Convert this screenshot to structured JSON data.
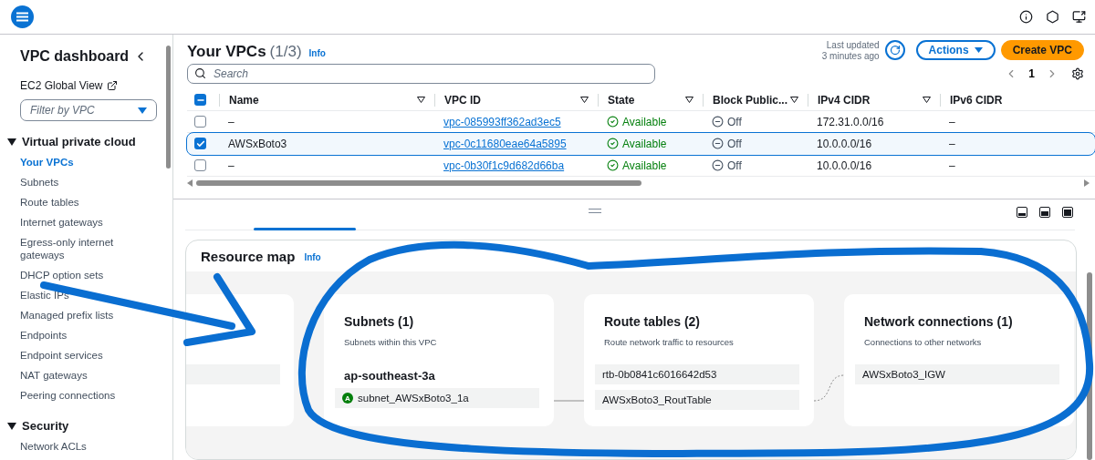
{
  "sidebar": {
    "title": "VPC dashboard",
    "global_view": "EC2 Global View",
    "filter": {
      "placeholder": "Filter by VPC"
    },
    "sections": [
      {
        "title": "Virtual private cloud",
        "expanded": true,
        "items": [
          {
            "label": "Your VPCs",
            "selected": true
          },
          {
            "label": "Subnets",
            "selected": false
          },
          {
            "label": "Route tables",
            "selected": false
          },
          {
            "label": "Internet gateways",
            "selected": false
          },
          {
            "label": "Egress-only internet gateways",
            "selected": false
          },
          {
            "label": "DHCP option sets",
            "selected": false
          },
          {
            "label": "Elastic IPs",
            "selected": false
          },
          {
            "label": "Managed prefix lists",
            "selected": false
          },
          {
            "label": "Endpoints",
            "selected": false
          },
          {
            "label": "Endpoint services",
            "selected": false
          },
          {
            "label": "NAT gateways",
            "selected": false
          },
          {
            "label": "Peering connections",
            "selected": false
          }
        ]
      },
      {
        "title": "Security",
        "expanded": true,
        "items": [
          {
            "label": "Network ACLs",
            "selected": false
          }
        ]
      }
    ]
  },
  "vpcs": {
    "title": "Your VPCs",
    "count": "(1/3)",
    "info": "Info",
    "last_updated": "Last updated",
    "updated_ago": "3 minutes ago",
    "actions": "Actions",
    "create": "Create VPC",
    "search": {
      "placeholder": "Search"
    },
    "page": "1",
    "header_checkbox": {
      "indeterminate": true
    },
    "columns": [
      "Name",
      "VPC ID",
      "State",
      "Block Public...",
      "IPv4 CIDR",
      "IPv6 CIDR"
    ],
    "rows": [
      {
        "name": "–",
        "vpc_id": "vpc-085993ff362ad3ec5",
        "state": "Available",
        "block_public": "Off",
        "ipv4": "172.31.0.0/16",
        "ipv6": "–",
        "selected": false
      },
      {
        "name": "AWSxBoto3",
        "vpc_id": "vpc-0c11680eae64a5895",
        "state": "Available",
        "block_public": "Off",
        "ipv4": "10.0.0.0/16",
        "ipv6": "–",
        "selected": true
      },
      {
        "name": "–",
        "vpc_id": "vpc-0b30f1c9d682d66ba",
        "state": "Available",
        "block_public": "Off",
        "ipv4": "10.0.0.0/16",
        "ipv6": "–",
        "selected": false
      }
    ]
  },
  "resource_map": {
    "title": "Resource map",
    "info": "Info",
    "cards": [
      {
        "kind": "clipped"
      },
      {
        "kind": "full",
        "title": "Subnets (1)",
        "subtitle": "Subnets within this VPC",
        "group": "ap-southeast-3a",
        "items": [
          {
            "label": "subnet_AWSxBoto3_1a",
            "badge": "A"
          }
        ]
      },
      {
        "kind": "full",
        "title": "Route tables (2)",
        "subtitle": "Route network traffic to resources",
        "items": [
          {
            "label": "rtb-0b0841c6016642d53"
          },
          {
            "label": "AWSxBoto3_RoutTable"
          }
        ]
      },
      {
        "kind": "full",
        "title": "Network connections (1)",
        "subtitle": "Connections to other networks",
        "items": [
          {
            "label": "AWSxBoto3_IGW"
          }
        ]
      }
    ]
  }
}
